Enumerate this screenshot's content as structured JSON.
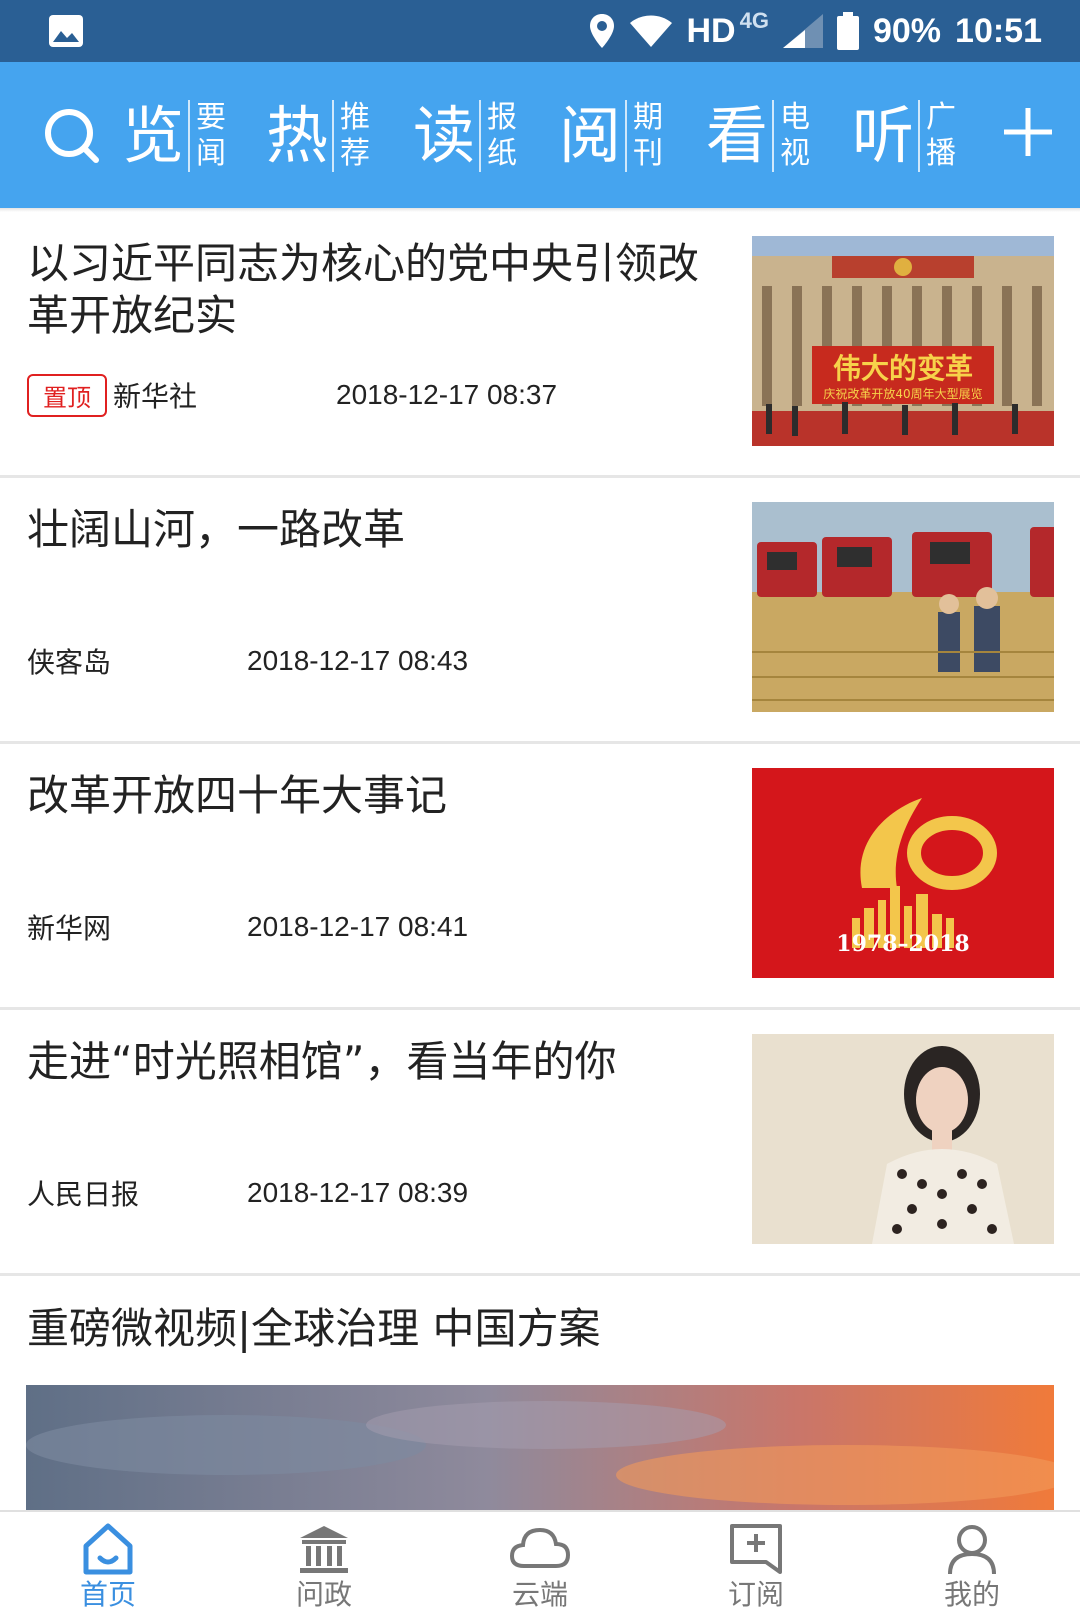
{
  "status_bar": {
    "hd": "HD",
    "network": "4G",
    "battery": "90%",
    "time": "10:51"
  },
  "top_nav": {
    "items": [
      {
        "main": "览",
        "sub1": "要",
        "sub2": "闻"
      },
      {
        "main": "热",
        "sub1": "推",
        "sub2": "荐"
      },
      {
        "main": "读",
        "sub1": "报",
        "sub2": "纸"
      },
      {
        "main": "阅",
        "sub1": "期",
        "sub2": "刊"
      },
      {
        "main": "看",
        "sub1": "电",
        "sub2": "视"
      },
      {
        "main": "听",
        "sub1": "广",
        "sub2": "播"
      }
    ]
  },
  "news": [
    {
      "title": "以习近平同志为核心的党中央引领改革开放纪实",
      "badge": "置顶",
      "source": "新华社",
      "date": "2018-12-17 08:37",
      "image_text": "伟大的变革",
      "image_subtext": "庆祝改革开放40周年大型展览"
    },
    {
      "title": "壮阔山河，一路改革",
      "source": "侠客岛",
      "date": "2018-12-17 08:43"
    },
    {
      "title": "改革开放四十年大事记",
      "source": "新华网",
      "date": "2018-12-17 08:41",
      "image_text": "1978–2018"
    },
    {
      "title": "走进“时光照相馆”，看当年的你",
      "source": "人民日报",
      "date": "2018-12-17 08:39"
    }
  ],
  "video": {
    "title": "重磅微视频|全球治理 中国方案"
  },
  "tab_bar": {
    "tabs": [
      {
        "label": "首页",
        "icon": "home-icon",
        "active": true
      },
      {
        "label": "问政",
        "icon": "government-building-icon"
      },
      {
        "label": "云端",
        "icon": "cloud-icon"
      },
      {
        "label": "订阅",
        "icon": "subscribe-icon"
      },
      {
        "label": "我的",
        "icon": "user-icon"
      }
    ],
    "active_color": "#3a8fe0"
  },
  "colors": {
    "status_bar": "#2a5f94",
    "nav": "#45a4ef",
    "badge": "#e02020"
  }
}
